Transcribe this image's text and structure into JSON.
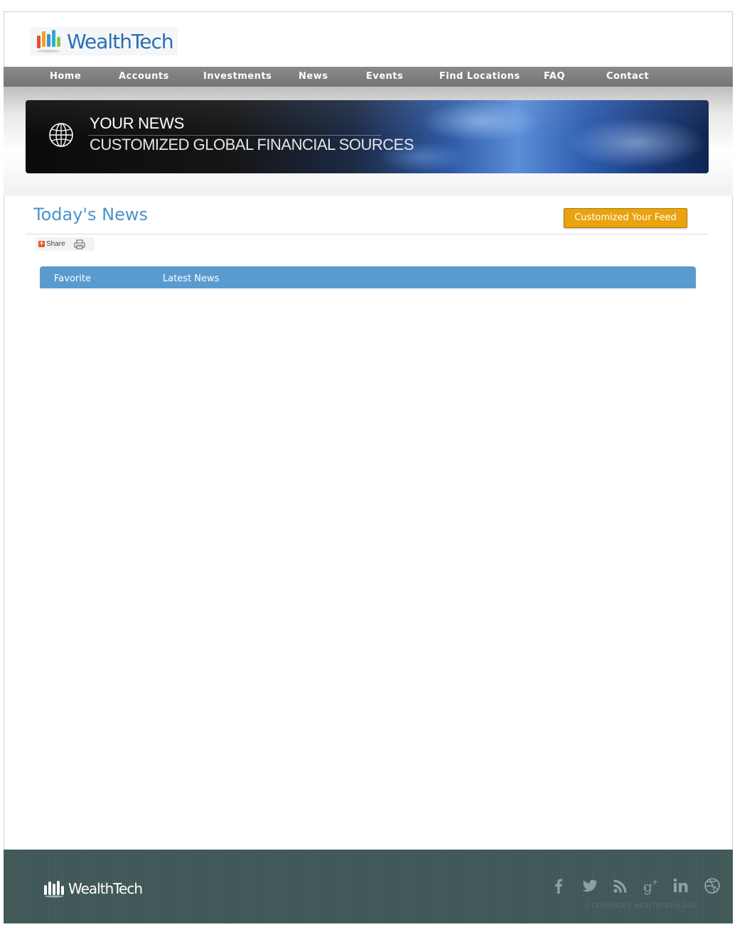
{
  "brand": {
    "name": "WealthTech"
  },
  "nav": {
    "items": [
      {
        "label": "Home"
      },
      {
        "label": "Accounts"
      },
      {
        "label": "Investments"
      },
      {
        "label": "News"
      },
      {
        "label": "Events"
      },
      {
        "label": "Find Locations"
      },
      {
        "label": "FAQ"
      },
      {
        "label": "Contact"
      }
    ]
  },
  "banner": {
    "title": "YOUR NEWS",
    "subtitle": "CUSTOMIZED GLOBAL FINANCIAL SOURCES",
    "icon": "globe-icon"
  },
  "main": {
    "title": "Today's News",
    "customize_button": "Customized Your Feed",
    "share_label": "Share",
    "tabs": [
      {
        "label": "Favorite"
      },
      {
        "label": "Latest News"
      }
    ]
  },
  "footer": {
    "brand": "WealthTech",
    "social": [
      "facebook-icon",
      "twitter-icon",
      "rss-icon",
      "google-plus-icon",
      "linkedin-icon",
      "dribbble-icon"
    ],
    "copyright": "©  COPYRIGHT WEALTHTECH 2015"
  },
  "colors": {
    "accent_blue": "#5a9bcf",
    "title_blue": "#4a94c9",
    "button_orange": "#e9a30f",
    "nav_gray": "#808080",
    "footer_bg": "#3f5656"
  }
}
